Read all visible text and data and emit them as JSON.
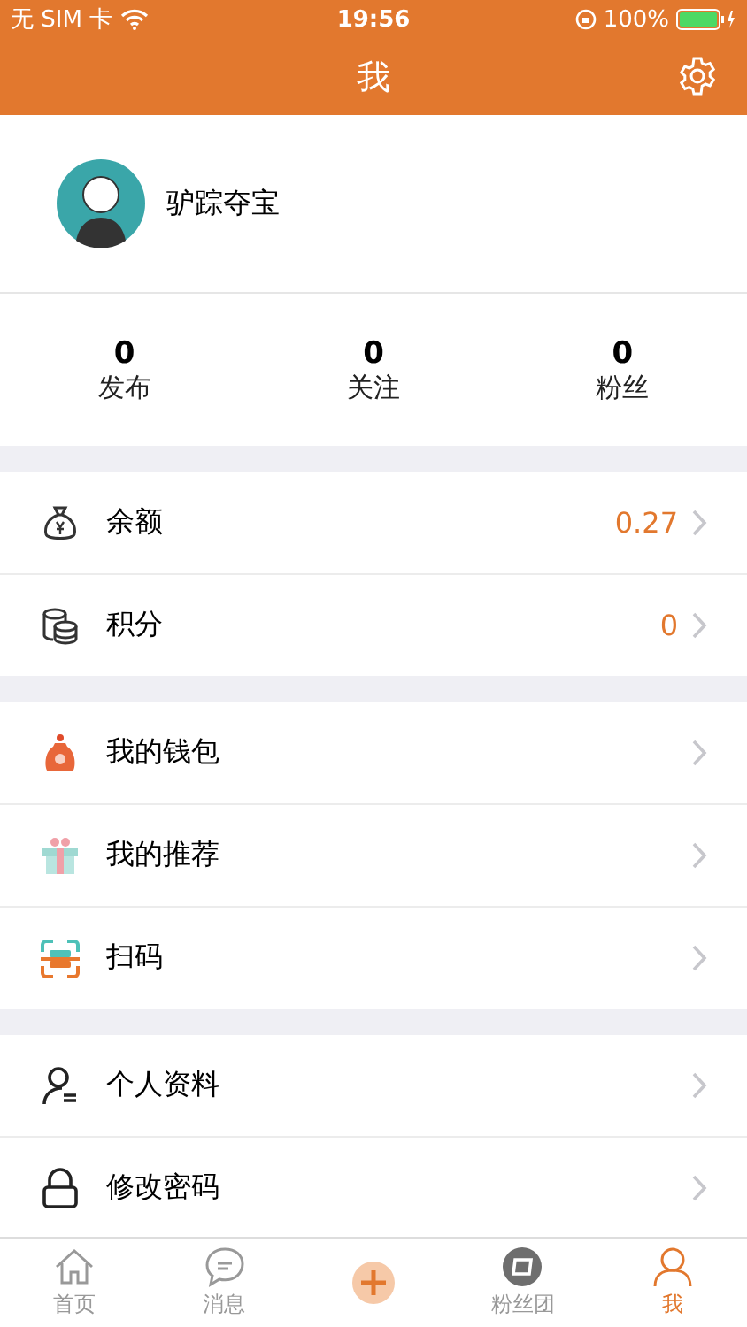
{
  "status_bar": {
    "carrier": "无 SIM 卡",
    "time": "19:56",
    "battery": "100%"
  },
  "nav": {
    "title": "我"
  },
  "profile": {
    "name": "驴踪夺宝"
  },
  "stats": [
    {
      "value": "0",
      "label": "发布"
    },
    {
      "value": "0",
      "label": "关注"
    },
    {
      "value": "0",
      "label": "粉丝"
    }
  ],
  "sections": [
    {
      "items": [
        {
          "label": "余额",
          "value": "0.27"
        },
        {
          "label": "积分",
          "value": "0"
        }
      ]
    },
    {
      "items": [
        {
          "label": "我的钱包"
        },
        {
          "label": "我的推荐"
        },
        {
          "label": "扫码"
        }
      ]
    },
    {
      "items": [
        {
          "label": "个人资料"
        },
        {
          "label": "修改密码"
        }
      ]
    }
  ],
  "tab_bar": [
    {
      "label": "首页",
      "selected": false
    },
    {
      "label": "消息",
      "selected": false
    },
    {
      "selected": false
    },
    {
      "label": "粉丝团",
      "selected": false
    },
    {
      "label": "我",
      "selected": true
    }
  ]
}
